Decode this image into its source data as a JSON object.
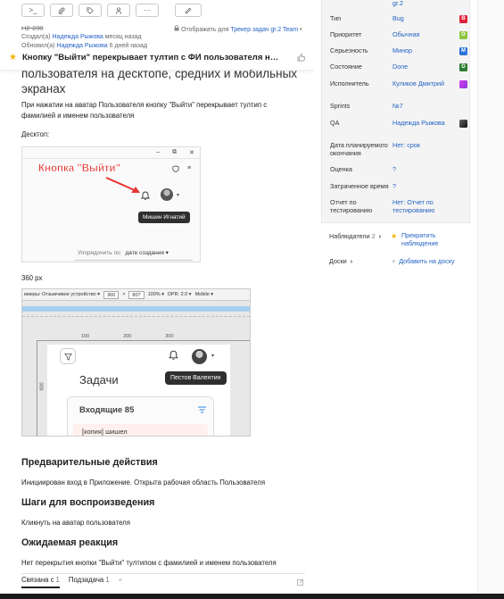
{
  "header": {
    "issue_key": "H2-230",
    "created_label": "Создал(а)",
    "created_by": "Надежда Рыжова",
    "created_when": "месяц назад",
    "updated_label": "Обновил(а)",
    "updated_by": "Надежда Рыжова",
    "updated_when": "6 дней назад",
    "display_for_prefix": "Отображать для",
    "display_for_link": "Трекер задач gr.2 Team",
    "sticky_title": "Кнопку \"Выйти\" перекрывает тултип с ФИ пользователя на деск..."
  },
  "toolbar": {
    "btn1": ">_",
    "btn2": "⎋",
    "btn3": "◇",
    "btn4": "♙",
    "btn5": "···",
    "edit": "✎"
  },
  "body": {
    "title_rest": "пользователя на десктопе, средних и мобильных экранах",
    "p1": "При нажатии на аватар Пользователя кнопку \"Выйти\" перекрывает тултип с фамилией и именем пользователя",
    "desktop_label": "Десктоп:",
    "size_label": "360 px",
    "h_pre": "Предварительные действия",
    "p_pre": "Инициирован вход в Приложение. Открыта рабочая область Пользователя",
    "h_steps": "Шаги для воспроизведения",
    "p_steps": "Кликнуть на аватар пользователя",
    "h_expected": "Ожидаемая реакция",
    "p_expected": "Нет перекрытия кнопки \"Выйти\" тултипом с фамилией и именем пользователя"
  },
  "shot1": {
    "annotation": "Кнопка \"Выйти\"",
    "tooltip": "Мишин Игнатий",
    "sort_label": "Упорядочить по:",
    "sort_value": "дате создания ▾",
    "win_min": "–",
    "win_max": "⧉",
    "win_close": "✕"
  },
  "shot2": {
    "device": "имеры: Отзывчивое устройство ▾",
    "width": "360",
    "x": "×",
    "height": "807",
    "zoom": "100% ▾",
    "dpr": "DPR: 2.0 ▾",
    "mode": "Mobile ▾",
    "ruler": [
      "100",
      "200",
      "300"
    ],
    "vruler": "800",
    "tasks": "Задачи",
    "tooltip": "Пестов Валентин",
    "inbox": "Входящие 85",
    "row": "[копия] шишел"
  },
  "bottom_tabs": {
    "linked": "Связана с",
    "linked_count": "1",
    "subtask": "Подзадача",
    "subtask_count": "1",
    "plus": "+"
  },
  "side": {
    "top_value": "gr.2",
    "type_label": "Тип",
    "type_value": "Bug",
    "type_badge": "B",
    "type_color": "#e0243a",
    "priority_label": "Приоритет",
    "priority_value": "Обычная",
    "priority_badge": "O",
    "priority_color": "#8cc63f",
    "severity_label": "Серьезность",
    "severity_value": "Минор",
    "severity_badge": "M",
    "severity_color": "#2b72d9",
    "state_label": "Состояние",
    "state_value": "Done",
    "state_badge": "D",
    "state_color": "#2e7d32",
    "assignee_label": "Исполнитель",
    "assignee_value": "Куликов Дмитрий",
    "sprints_label": "Sprints",
    "sprints_value": "№7",
    "qa_label": "QA",
    "qa_value": "Надежда Рыжова",
    "plan_label": "Дата планируемого окончания",
    "plan_value": "Нет: срок",
    "estimate_label": "Оценка",
    "estimate_value": "?",
    "spent_label": "Затраченное время",
    "spent_value": "?",
    "report_label": "Отчет по тестированию",
    "report_value": "Нет: Отчет по тестированию",
    "watchers_label": "Наблюдатели",
    "watchers_count": "2",
    "watch_link": "Прекратить наблюдение",
    "boards_label": "Доски",
    "add_board": "Добавить на доску"
  }
}
